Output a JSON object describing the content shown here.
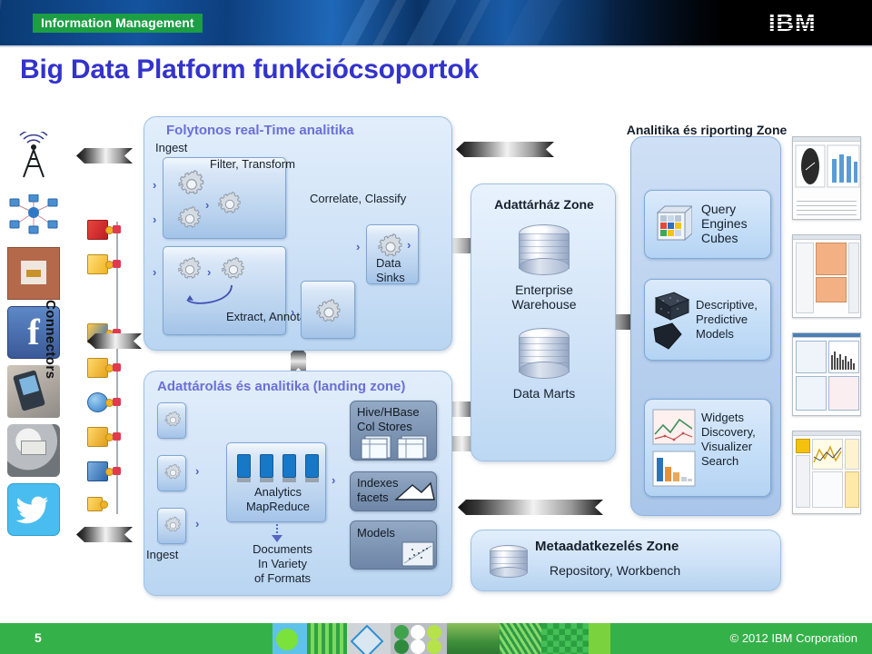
{
  "header": {
    "badge": "Information Management",
    "brand": "IBM"
  },
  "title": "Big Data Platform funkciócsoportok",
  "footer": {
    "page_number": "5",
    "copyright": "© 2012 IBM Corporation",
    "band_color": "#35b14a"
  },
  "colors": {
    "title": "#3333cc",
    "zone_title_violet": "#6b6fd6",
    "zone_title_dark": "#16202b",
    "badge_green": "#1c9e45"
  },
  "connectors": {
    "label": "Connectors"
  },
  "sources": [
    {
      "name": "radio-tower-icon",
      "glyph": "ᵯC"
    },
    {
      "name": "network-diagram-icon",
      "glyph": "❉"
    },
    {
      "name": "rfid-tag-icon",
      "glyph": ""
    },
    {
      "name": "facebook-icon",
      "glyph": "f"
    },
    {
      "name": "mobile-phone-icon",
      "glyph": ""
    },
    {
      "name": "smart-meter-icon",
      "glyph": ""
    },
    {
      "name": "twitter-icon",
      "glyph": "t"
    }
  ],
  "zones": {
    "realtime": {
      "title": "Folytonos real-Time analitika",
      "ingest_label": "Ingest",
      "filter_transform": "Filter, Transform",
      "correlate_classify": "Correlate, Classify",
      "data_sinks": "Data\nSinks",
      "extract_annotate": "Extract, Annotate"
    },
    "landing": {
      "title": "Adattárolás és analitika (landing zone)",
      "ingest_label": "Ingest",
      "analytics_mapreduce": "Analytics\nMapReduce",
      "documents": "Documents\nIn Variety\nof Formats",
      "hive_hbase": "Hive/HBase\nCol Stores",
      "indexes_facets": "Indexes\nfacets",
      "models": "Models"
    },
    "warehouse": {
      "title": "Adattárház Zone",
      "enterprise_warehouse": "Enterprise\nWarehouse",
      "data_marts": "Data Marts"
    },
    "analytics": {
      "title": "Analitika és riporting Zone",
      "query_engines": "Query\nEngines\nCubes",
      "descriptive_predictive": "Descriptive,\nPredictive\nModels",
      "widgets": "Widgets\nDiscovery,\nVisualizer\nSearch"
    },
    "metadata": {
      "title": "Metaadatkezelés  Zone",
      "subtitle": "Repository, Workbench"
    }
  }
}
